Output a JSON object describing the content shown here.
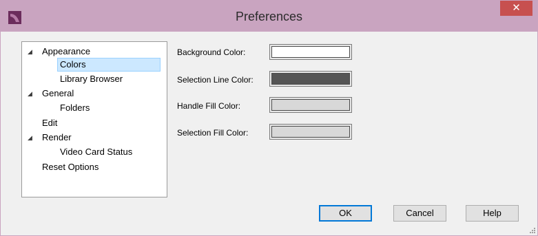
{
  "window": {
    "title": "Preferences",
    "close_symbol": "✕",
    "title_bar_color": "#c9a4c0"
  },
  "tree": {
    "items": [
      {
        "label": "Appearance",
        "expanded": true
      },
      {
        "label": "Colors",
        "selected": true
      },
      {
        "label": "Library Browser"
      },
      {
        "label": "General",
        "expanded": true
      },
      {
        "label": "Folders"
      },
      {
        "label": "Edit"
      },
      {
        "label": "Render",
        "expanded": true
      },
      {
        "label": "Video Card Status"
      },
      {
        "label": "Reset Options"
      }
    ],
    "expand_glyph": "◢"
  },
  "colors": {
    "fields": [
      {
        "label": "Background Color:",
        "color": "#ffffff"
      },
      {
        "label": "Selection Line Color:",
        "color": "#555555"
      },
      {
        "label": "Handle Fill Color:",
        "color": "#d8d8d8"
      },
      {
        "label": "Selection Fill Color:",
        "color": "#d8d8d8"
      }
    ]
  },
  "buttons": {
    "ok": "OK",
    "cancel": "Cancel",
    "help": "Help"
  }
}
